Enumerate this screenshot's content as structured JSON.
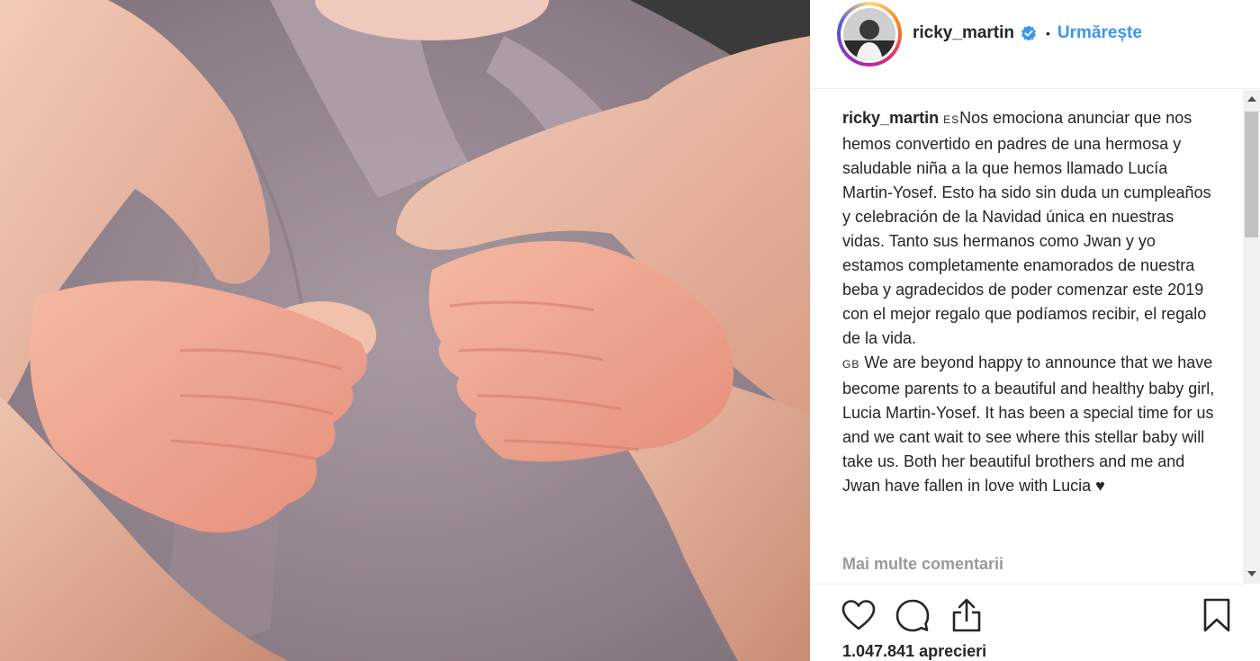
{
  "post": {
    "username": "ricky_martin",
    "follow_label": "Urmărește",
    "separator": "•"
  },
  "caption": {
    "username": "ricky_martin",
    "es_flag": "ES",
    "es_text": "Nos emociona anunciar que nos hemos convertido en padres de una hermosa y saludable niña a la que hemos llamado Lucía Martin-Yosef. Esto ha sido sin duda un cumpleaños y celebración de la Navidad única en nuestras vidas. Tanto sus hermanos como Jwan y yo estamos completamente enamorados de nuestra beba y agradecidos de poder comenzar este 2019 con el mejor regalo que podíamos recibir, el regalo de la vida.",
    "gb_flag": "GB",
    "gb_text": "We are beyond happy to announce that we have become parents to a beautiful and healthy baby girl, Lucia Martin-Yosef. It has been a special time for us and we cant wait to see where this stellar baby will take us. Both her beautiful brothers and me and Jwan have fallen in love with Lucia ♥"
  },
  "more_comments_label": "Mai multe comentarii",
  "likes_label": "1.047.841 aprecieri",
  "icons": {
    "verified": "verified-badge-icon",
    "like": "heart-icon",
    "comment": "comment-icon",
    "share": "share-icon",
    "save": "bookmark-icon"
  },
  "colors": {
    "accent": "#3897f0",
    "muted": "#999999",
    "text": "#262626"
  }
}
